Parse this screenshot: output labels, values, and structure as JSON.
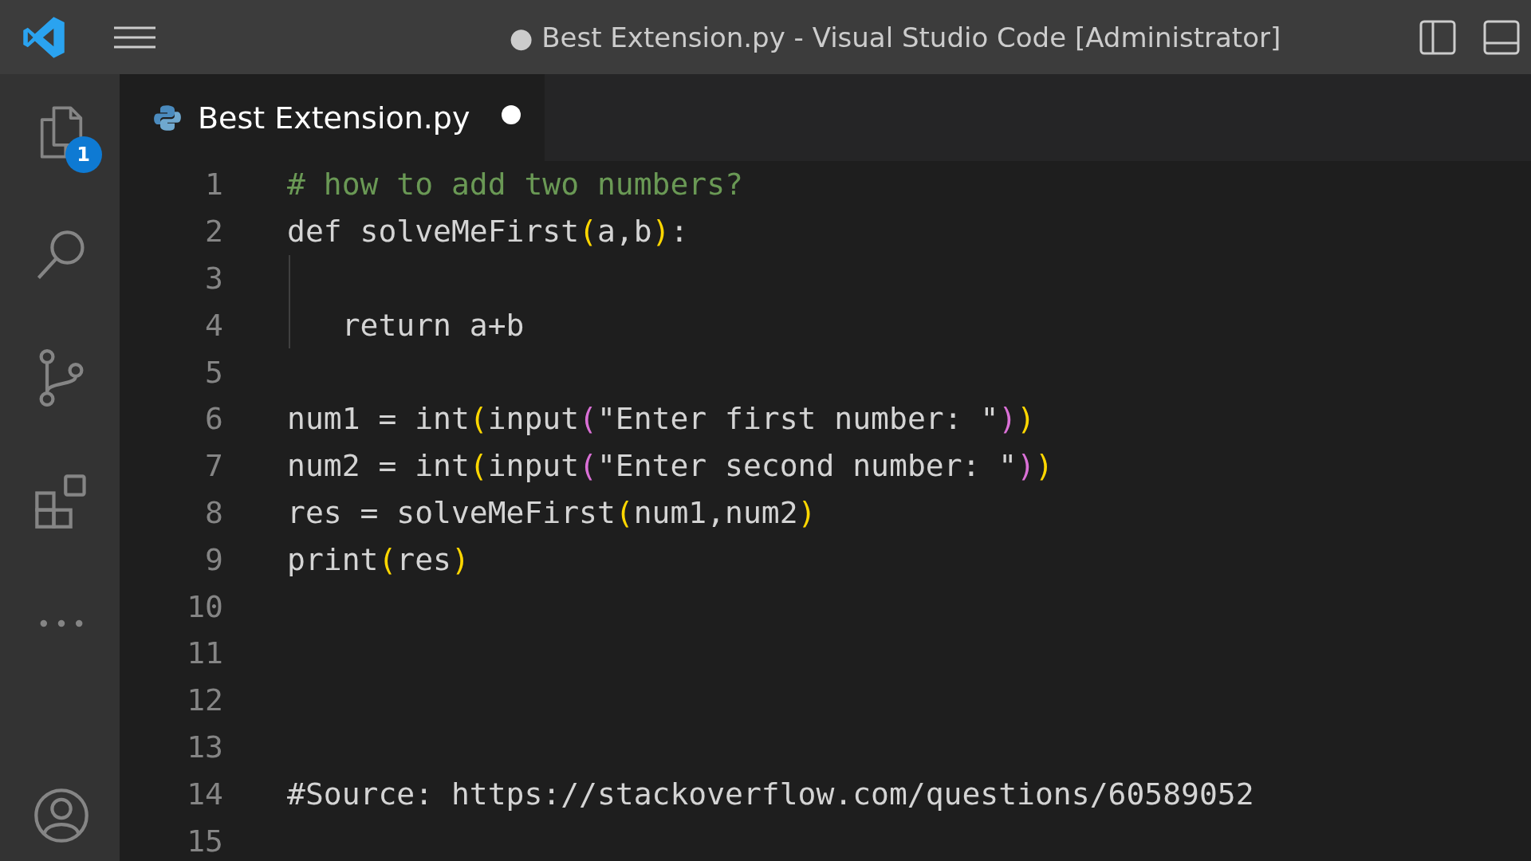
{
  "window": {
    "title": "● Best Extension.py - Visual Studio Code [Administrator]"
  },
  "activity_bar": {
    "items": [
      {
        "kind": "files",
        "selected": false,
        "badge": "1"
      },
      {
        "kind": "search",
        "selected": false
      },
      {
        "kind": "source-control",
        "selected": false
      },
      {
        "kind": "extensions",
        "selected": false
      },
      {
        "kind": "more",
        "selected": false
      }
    ],
    "bottom_items": [
      {
        "kind": "account",
        "selected": false
      }
    ]
  },
  "tabs": [
    {
      "label": "Best Extension.py",
      "selected": true,
      "modified": true
    }
  ],
  "editor": {
    "lines": [
      {
        "number": "1",
        "tokens": [
          {
            "kind": "comment",
            "text": "# how to add two numbers?"
          }
        ]
      },
      {
        "number": "2",
        "tokens": [
          {
            "kind": "plain",
            "text": "def solveMeFirst"
          },
          {
            "kind": "bracket1",
            "text": "("
          },
          {
            "kind": "plain",
            "text": "a,b"
          },
          {
            "kind": "bracket1",
            "text": ")"
          },
          {
            "kind": "plain",
            "text": ":"
          }
        ]
      },
      {
        "number": "3",
        "indent_guide": true
      },
      {
        "number": "4",
        "indent_guide": true,
        "tokens": [
          {
            "kind": "plain",
            "text": "   return a+b"
          }
        ]
      },
      {
        "number": "5"
      },
      {
        "number": "6",
        "tokens": [
          {
            "kind": "plain",
            "text": "num1 = int"
          },
          {
            "kind": "bracket1",
            "text": "("
          },
          {
            "kind": "plain",
            "text": "input"
          },
          {
            "kind": "bracket2",
            "text": "("
          },
          {
            "kind": "plain",
            "text": "\"Enter first number: \""
          },
          {
            "kind": "bracket2",
            "text": ")"
          },
          {
            "kind": "bracket1",
            "text": ")"
          }
        ]
      },
      {
        "number": "7",
        "tokens": [
          {
            "kind": "plain",
            "text": "num2 = int"
          },
          {
            "kind": "bracket1",
            "text": "("
          },
          {
            "kind": "plain",
            "text": "input"
          },
          {
            "kind": "bracket2",
            "text": "("
          },
          {
            "kind": "plain",
            "text": "\"Enter second number: \""
          },
          {
            "kind": "bracket2",
            "text": ")"
          },
          {
            "kind": "bracket1",
            "text": ")"
          }
        ]
      },
      {
        "number": "8",
        "tokens": [
          {
            "kind": "plain",
            "text": "res = solveMeFirst"
          },
          {
            "kind": "bracket1",
            "text": "("
          },
          {
            "kind": "plain",
            "text": "num1,num2"
          },
          {
            "kind": "bracket1",
            "text": ")"
          }
        ]
      },
      {
        "number": "9",
        "tokens": [
          {
            "kind": "plain",
            "text": "print"
          },
          {
            "kind": "bracket1",
            "text": "("
          },
          {
            "kind": "plain",
            "text": "res"
          },
          {
            "kind": "bracket1",
            "text": ")"
          }
        ]
      },
      {
        "number": "10"
      },
      {
        "number": "11"
      },
      {
        "number": "12"
      },
      {
        "number": "13"
      },
      {
        "number": "14",
        "tokens": [
          {
            "kind": "plain",
            "text": "#Source: https://stackoverflow.com/questions/60589052"
          }
        ]
      },
      {
        "number": "15"
      }
    ]
  }
}
